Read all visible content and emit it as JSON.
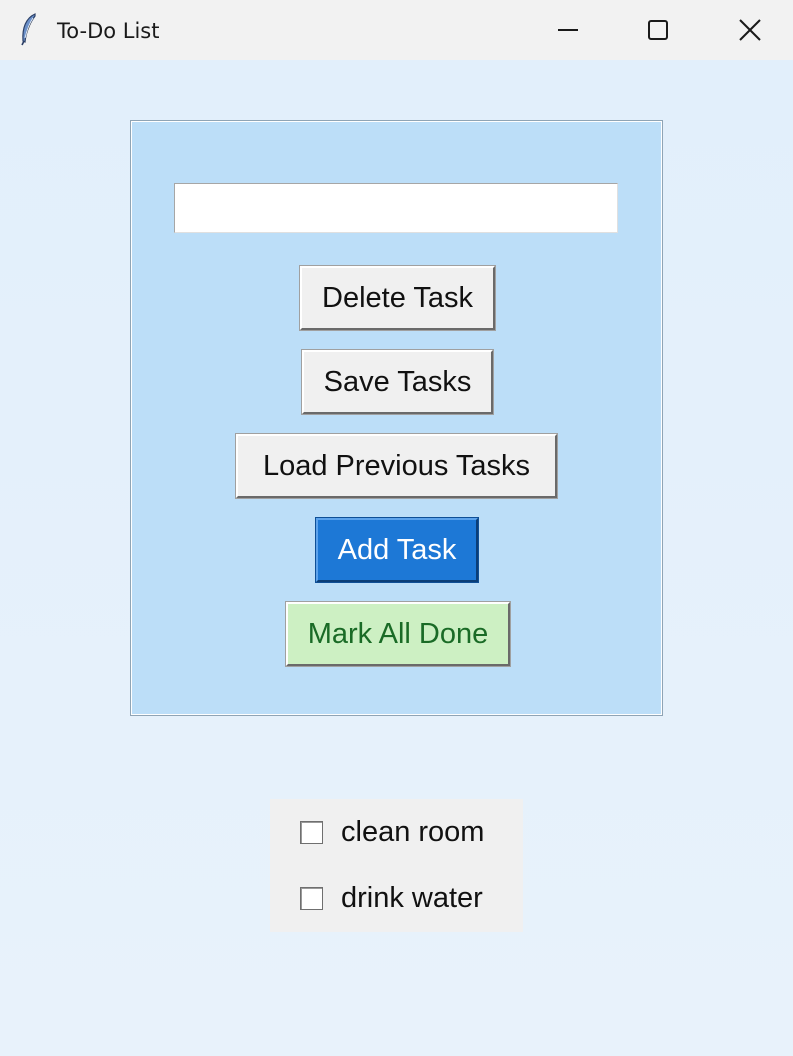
{
  "window": {
    "title": "To-Do List",
    "controls": [
      "minimize-icon",
      "maximize-icon",
      "close-icon"
    ]
  },
  "form": {
    "task_input_value": "",
    "task_input_placeholder": "",
    "delete_label": "Delete Task",
    "save_label": "Save Tasks",
    "load_label": "Load Previous Tasks",
    "add_label": "Add Task",
    "mark_all_label": "Mark All Done"
  },
  "tasks": [
    {
      "label": "clean room",
      "checked": false
    },
    {
      "label": "drink water",
      "checked": false
    }
  ],
  "colors": {
    "frame_bg": "#bcdef8",
    "add_button_bg": "#1d78d6",
    "mark_all_bg": "#cdf0c3",
    "mark_all_text": "#1a6b26",
    "window_bg": "#e6f1fb"
  }
}
